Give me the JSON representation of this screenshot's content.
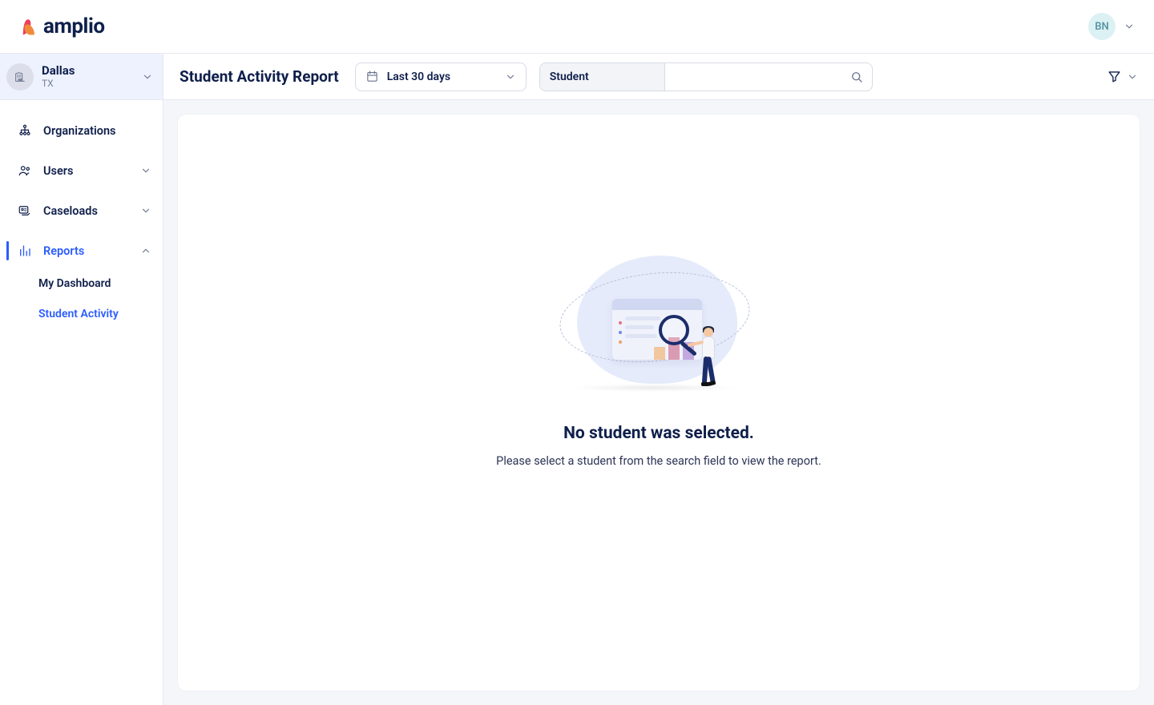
{
  "brand": {
    "name": "amplio"
  },
  "user": {
    "initials": "BN"
  },
  "org": {
    "name": "Dallas",
    "region": "TX"
  },
  "sidebar": {
    "items": [
      {
        "label": "Organizations"
      },
      {
        "label": "Users"
      },
      {
        "label": "Caseloads"
      },
      {
        "label": "Reports"
      }
    ],
    "reportsChildren": [
      {
        "label": "My Dashboard"
      },
      {
        "label": "Student Activity"
      }
    ]
  },
  "page": {
    "title": "Student Activity Report",
    "dateRange": "Last 30 days",
    "searchType": "Student",
    "searchValue": ""
  },
  "empty": {
    "title": "No student was selected.",
    "subtitle": "Please select a student from the search field to view the report."
  }
}
